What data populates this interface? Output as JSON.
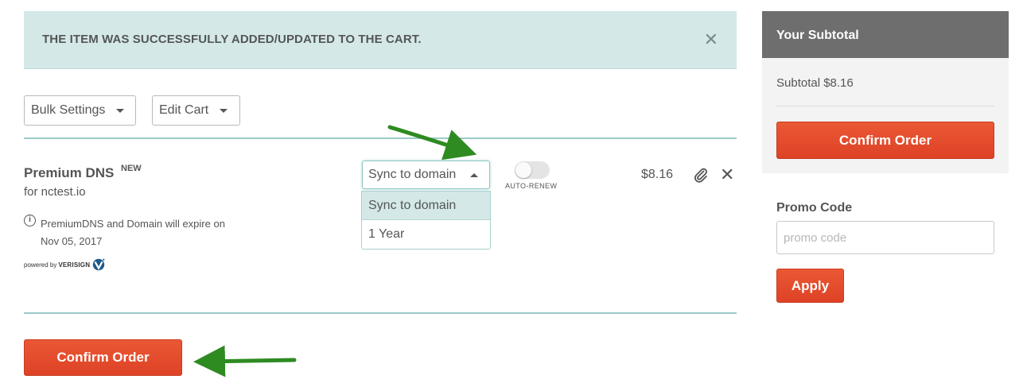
{
  "alert": {
    "message": "THE ITEM WAS SUCCESSFULLY ADDED/UPDATED TO THE CART.",
    "close_icon": "close-icon"
  },
  "toolbar": {
    "bulk_settings_label": "Bulk Settings",
    "edit_cart_label": "Edit Cart"
  },
  "cart_item": {
    "name": "Premium DNS",
    "badge": "NEW",
    "for_domain": "for nctest.io",
    "info_line1": "PremiumDNS and Domain will expire on",
    "info_line2": "Nov 05, 2017",
    "powered_by_prefix": "powered by",
    "powered_by_brand": "VERISIGN",
    "duration_select": {
      "value": "Sync to domain",
      "options": [
        "Sync to domain",
        "1 Year"
      ]
    },
    "auto_renew_label": "AUTO-RENEW",
    "auto_renew_enabled": false,
    "price": "$8.16"
  },
  "confirm_order_label": "Confirm Order",
  "subtotal_panel": {
    "title": "Your Subtotal",
    "subtotal_text": "Subtotal $8.16",
    "confirm_label": "Confirm Order"
  },
  "promo": {
    "label": "Promo Code",
    "placeholder": "promo code",
    "value": "",
    "apply_label": "Apply"
  },
  "colors": {
    "alert_bg": "#d4e8e8",
    "accent_teal": "#9ccac8",
    "primary_red": "#e44c2f",
    "panel_header": "#6e6e6e",
    "annotation_arrow": "#2e8b22"
  }
}
